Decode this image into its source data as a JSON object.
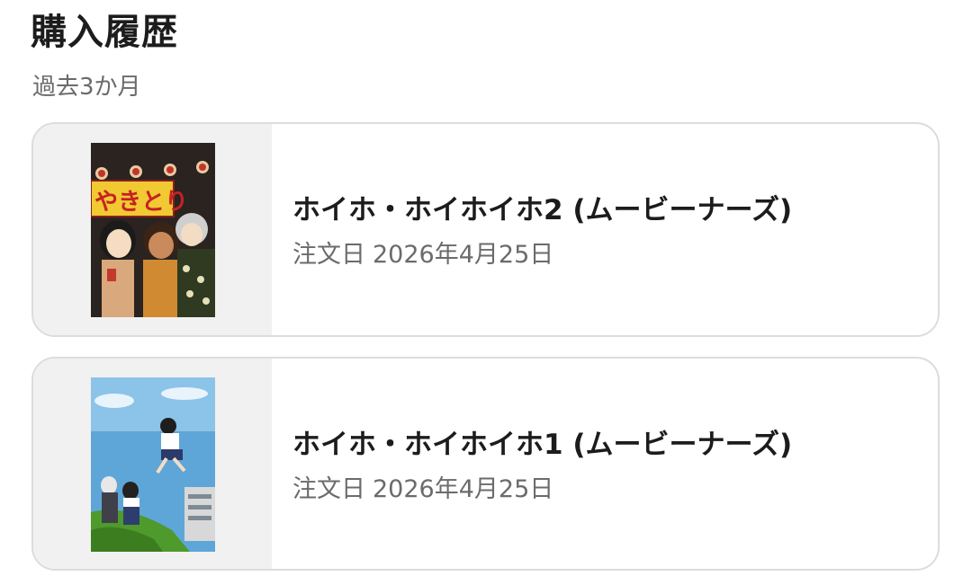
{
  "header": {
    "title": "購入履歴",
    "subtitle": "過去3か月"
  },
  "orders": [
    {
      "title": "ホイホ・ホイホイホ2 (ムービーナーズ)",
      "date_label": "注文日",
      "date": "2026年4月25日",
      "cover_icon": "book-cover-volume-2"
    },
    {
      "title": "ホイホ・ホイホイホ1 (ムービーナーズ)",
      "date_label": "注文日",
      "date": "2026年4月25日",
      "cover_icon": "book-cover-volume-1"
    }
  ]
}
